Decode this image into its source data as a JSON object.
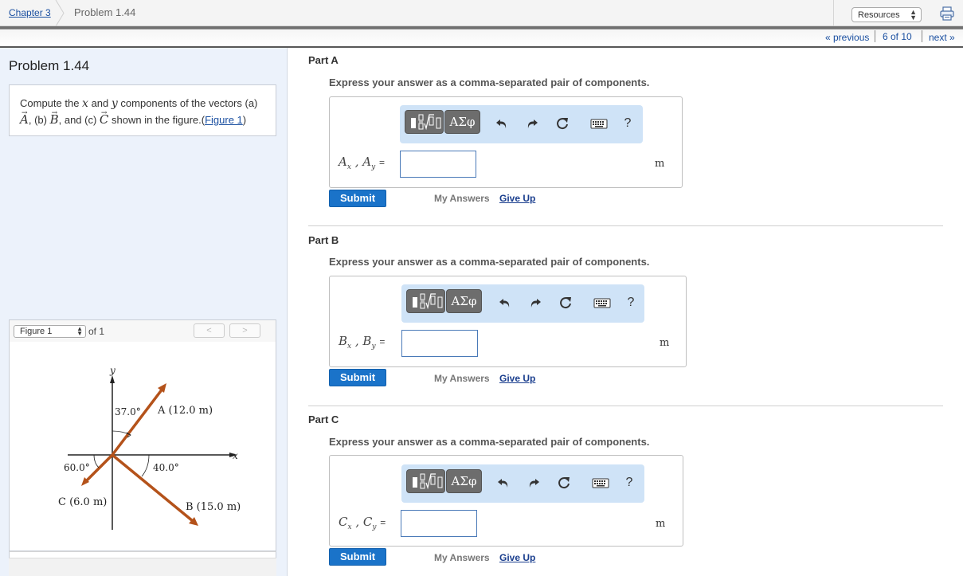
{
  "breadcrumb": {
    "chapter": "Chapter 3",
    "problem": "Problem 1.44"
  },
  "header": {
    "resources_label": "Resources"
  },
  "nav": {
    "previous": "« previous",
    "position": "6 of 10",
    "next": "next »"
  },
  "problem": {
    "title": "Problem 1.44",
    "text_1": "Compute the ",
    "var_x": "x",
    "text_2": " and ",
    "var_y": "y",
    "text_3": " components of the vectors (a) ",
    "vec_a": "A",
    "text_4": ", (b) ",
    "vec_b": "B",
    "text_5": ", and (c) ",
    "vec_c": "C",
    "text_6": " shown in the figure.(",
    "figure_link": "Figure 1",
    "text_7": ")"
  },
  "figure_panel": {
    "selected": "Figure 1",
    "of_label": "of 1",
    "prev_glyph": "<",
    "next_glyph": ">",
    "figure": {
      "axis_y": "y",
      "axis_x": "x",
      "label_a": "A (12.0 m)",
      "label_b": "B (15.0 m)",
      "label_c": "C (6.0 m)",
      "angle_a": "37.0°",
      "angle_b": "40.0°",
      "angle_c": "60.0°",
      "color_vectors": "#b4521a"
    }
  },
  "parts": [
    {
      "label": "Part A",
      "instruction": "Express your answer as a comma-separated pair of components.",
      "var": "A",
      "unit": "m",
      "submit": "Submit",
      "my_answers": "My Answers",
      "give_up": "Give Up"
    },
    {
      "label": "Part B",
      "instruction": "Express your answer as a comma-separated pair of components.",
      "var": "B",
      "unit": "m",
      "submit": "Submit",
      "my_answers": "My Answers",
      "give_up": "Give Up"
    },
    {
      "label": "Part C",
      "instruction": "Express your answer as a comma-separated pair of components.",
      "var": "C",
      "unit": "m",
      "submit": "Submit",
      "my_answers": "My Answers",
      "give_up": "Give Up"
    }
  ],
  "toolbar": {
    "greek_label": "ΑΣφ",
    "help_label": "?",
    "icons": [
      "template-icon",
      "greek-symbols-icon",
      "undo-icon",
      "redo-icon",
      "reset-icon",
      "keyboard-icon",
      "help-icon"
    ]
  },
  "colors": {
    "accent": "#1a73c9",
    "toolbar_bg": "#cfe3f7",
    "left_panel_bg": "#ecf2fb"
  }
}
